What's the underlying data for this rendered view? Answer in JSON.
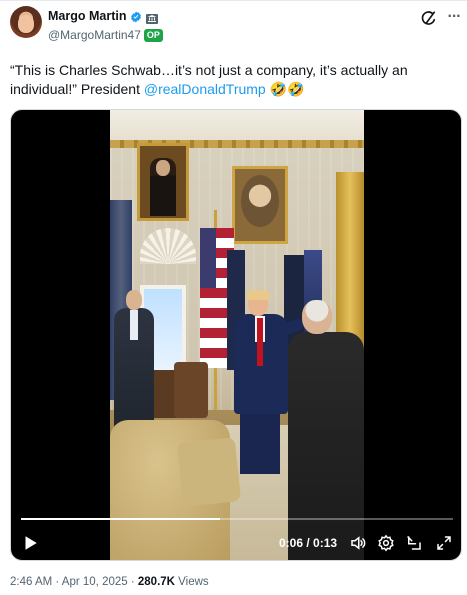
{
  "author": {
    "display_name": "Margo Martin",
    "handle": "@MargoMartin47",
    "badge": "OP"
  },
  "icons": {
    "verified": "verified-badge-icon",
    "affiliation": "government-building-icon",
    "grok": "grok-icon",
    "more": "more-options-icon"
  },
  "tweet": {
    "text_part1": "“This is Charles Schwab…it’s not just a company, it’s actually an individual!” President ",
    "mention": "@realDonaldTrump",
    "emoji": " 🤣🤣"
  },
  "video": {
    "time_label": "0:06 / 0:13",
    "progress_fraction": 0.46
  },
  "meta": {
    "time": "2:46 AM",
    "separator1": " · ",
    "date": "Apr 10, 2025",
    "separator2": " · ",
    "views_count": "280.7K",
    "views_label": " Views"
  },
  "colors": {
    "accent": "#1d9bf0",
    "verified": "#1d9bf0",
    "op_badge": "#1ea34a"
  }
}
